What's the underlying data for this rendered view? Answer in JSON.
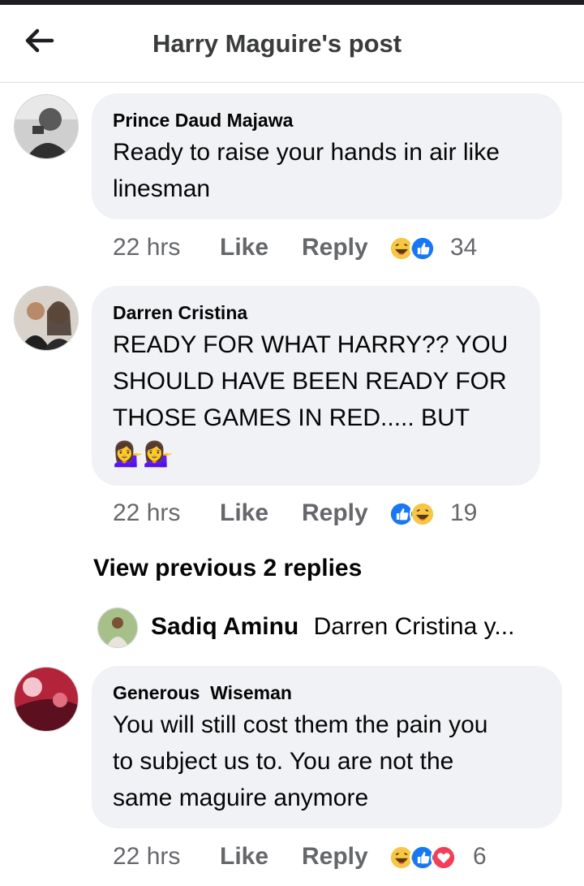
{
  "header": {
    "title": "Harry Maguire's post"
  },
  "comments": [
    {
      "author": "Prince Daud Majawa",
      "lines": [
        "Ready to raise your hands in air like",
        "linesman"
      ],
      "time": "22 hrs",
      "like": "Like",
      "reply": "Reply",
      "reactions": [
        "haha-icon",
        "like-icon"
      ],
      "count": "34"
    },
    {
      "author": "Darren Cristina",
      "lines": [
        "READY FOR WHAT HARRY?? YOU",
        "SHOULD HAVE BEEN READY FOR",
        "THOSE GAMES IN RED..... BUT",
        "💁‍♀️💁‍♀️"
      ],
      "time": "22 hrs",
      "like": "Like",
      "reply": "Reply",
      "reactions": [
        "like-icon",
        "haha-icon"
      ],
      "count": "19"
    },
    {
      "author": "Generous  Wiseman",
      "lines": [
        "You will still cost them the pain you",
        "to subject us to. You are not the",
        "same maguire anymore"
      ],
      "time": "22 hrs",
      "like": "Like",
      "reply": "Reply",
      "reactions": [
        "haha-icon",
        "like-icon",
        "love-icon"
      ],
      "count": "6"
    }
  ],
  "view_previous": "View previous 2 replies",
  "reply_preview": {
    "author": "Sadiq Aminu",
    "text": "Darren Cristina y..."
  },
  "colors": {
    "meta": "#65676b",
    "bubble": "#f0f2f5",
    "like_blue": "#1877f2",
    "haha_yellow": "#f7c645",
    "love_red": "#f33e58"
  }
}
